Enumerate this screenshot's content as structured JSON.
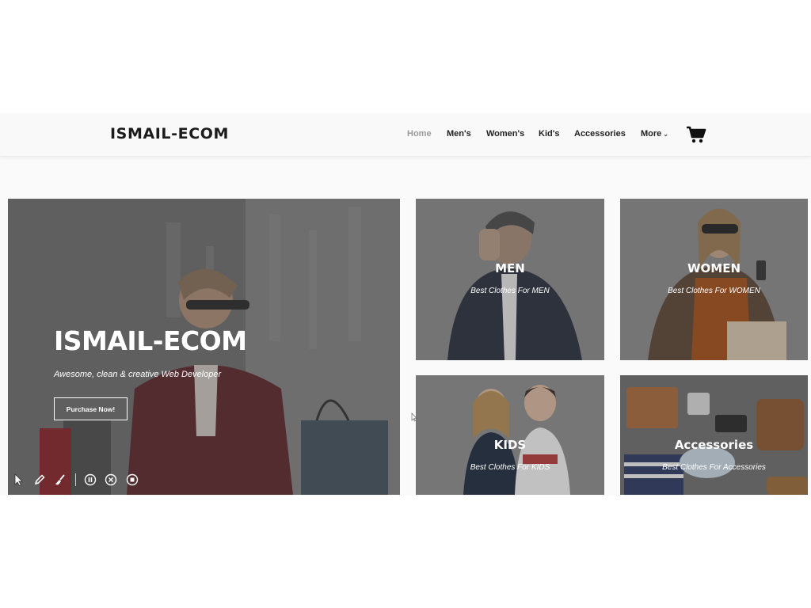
{
  "brand": {
    "name": "ISMAIL-ECOM"
  },
  "nav": {
    "items": [
      {
        "label": "Home",
        "active": true
      },
      {
        "label": "Men's"
      },
      {
        "label": "Women's"
      },
      {
        "label": "Kid's"
      },
      {
        "label": "Accessories"
      },
      {
        "label": "More"
      }
    ],
    "more_caret": "⌄",
    "cart_icon": "shopping-cart-icon"
  },
  "hero": {
    "title": "ISMAIL-ECOM",
    "subtitle": "Awesome, clean & creative Web Developer",
    "button_label": "Purchase Now!"
  },
  "categories": [
    {
      "title": "MEN",
      "subtitle": "Best Clothes For MEN"
    },
    {
      "title": "WOMEN",
      "subtitle": "Best Clothes For WOMEN"
    },
    {
      "title": "KIDS",
      "subtitle": "Best Clothes For KIDS"
    },
    {
      "title": "Accessories",
      "subtitle": "Best Clothes For Accessories"
    }
  ],
  "toolbar": {
    "tools": [
      "pointer-icon",
      "pencil-icon",
      "brush-icon",
      "pause-icon",
      "close-circle-icon",
      "stop-icon"
    ]
  },
  "colors": {
    "overlay": "#5f5f5f",
    "text_dark": "#1b1b1b",
    "nav_active": "#9a9a9a"
  }
}
